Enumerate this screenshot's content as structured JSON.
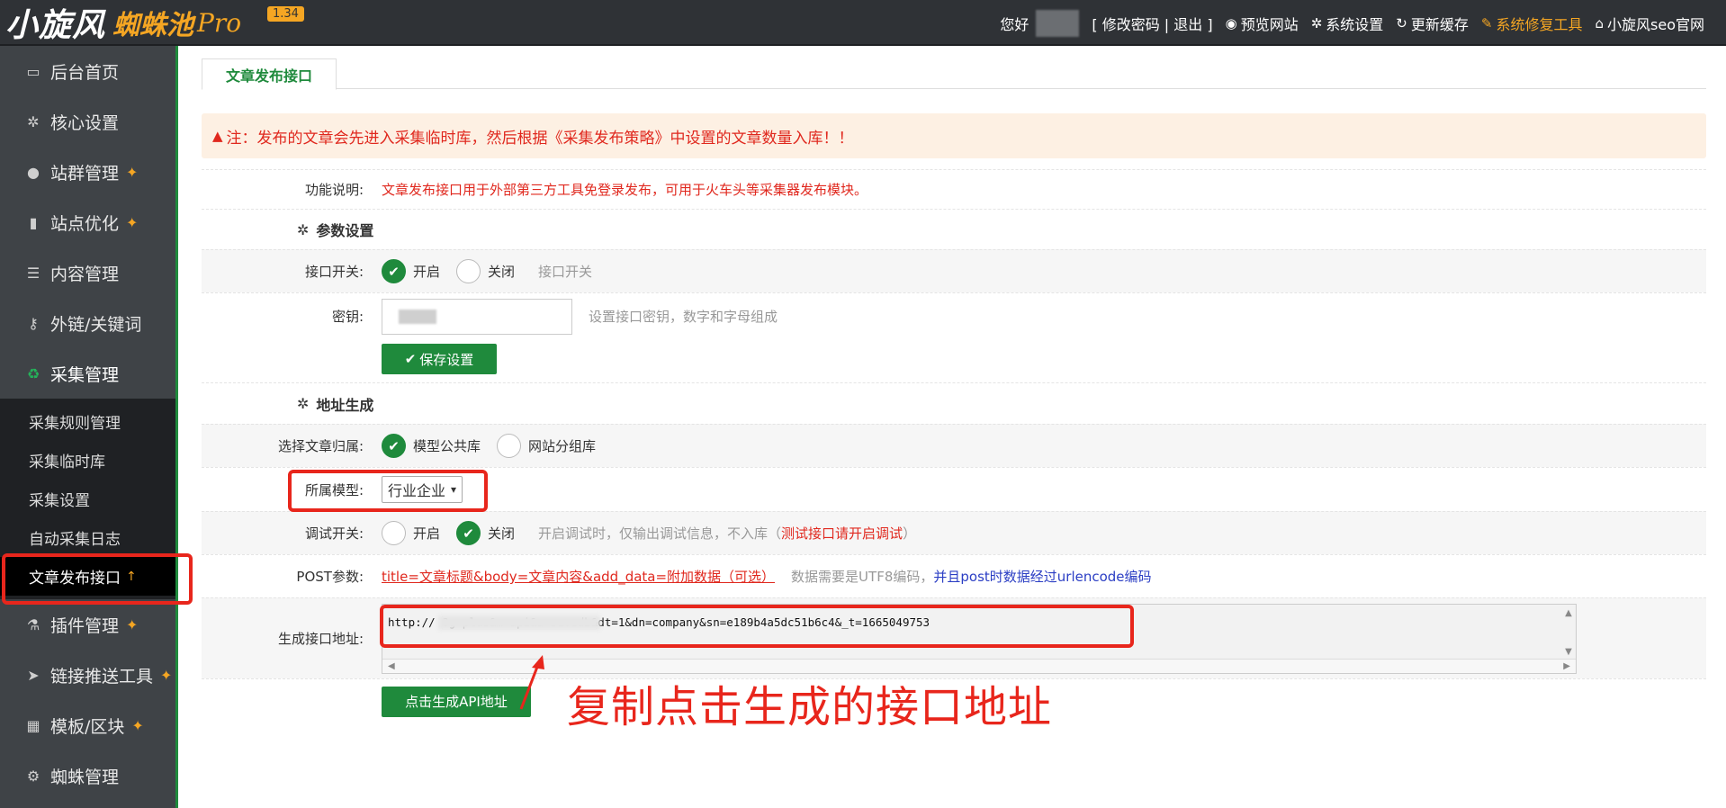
{
  "header": {
    "logo_main": "小旋风",
    "logo_sub": "蜘蛛池",
    "logo_pro": "Pro",
    "version": "1.34",
    "greeting": "您好",
    "account_links": "[ 修改密码 | 退出 ]",
    "nav": [
      {
        "icon": "eye-icon",
        "label": "预览网站"
      },
      {
        "icon": "gear-icon",
        "label": "系统设置"
      },
      {
        "icon": "refresh-icon",
        "label": "更新缓存"
      },
      {
        "icon": "wrench-icon",
        "label": "系统修复工具"
      },
      {
        "icon": "home-icon",
        "label": "小旋风seo官网"
      }
    ]
  },
  "sidebar": {
    "items": [
      {
        "label": "后台首页",
        "icon": "monitor-icon"
      },
      {
        "label": "核心设置",
        "icon": "gear-icon"
      },
      {
        "label": "站群管理",
        "icon": "user-icon",
        "pin": true
      },
      {
        "label": "站点优化",
        "icon": "bar-chart-icon",
        "pin": true
      },
      {
        "label": "内容管理",
        "icon": "document-icon"
      },
      {
        "label": "外链/关键词",
        "icon": "key-icon"
      },
      {
        "label": "采集管理",
        "icon": "recycle-icon",
        "active": true
      },
      {
        "label": "插件管理",
        "icon": "flask-icon",
        "pin": true
      },
      {
        "label": "链接推送工具",
        "icon": "send-icon",
        "pin": true
      },
      {
        "label": "模板/区块",
        "icon": "grid-icon",
        "pin": true
      },
      {
        "label": "蜘蛛管理",
        "icon": "android-icon"
      }
    ],
    "sub_items": [
      "采集规则管理",
      "采集临时库",
      "采集设置",
      "自动采集日志",
      "文章发布接口"
    ],
    "current_sub": "文章发布接口"
  },
  "main": {
    "tab": "文章发布接口",
    "notice": "注：发布的文章会先进入采集临时库，然后根据《采集发布策略》中设置的文章数量入库！！",
    "func_label": "功能说明:",
    "func_desc": "文章发布接口用于外部第三方工具免登录发布，可用于火车头等采集器发布模块。",
    "section_params": "参数设置",
    "switch_label": "接口开关:",
    "switch_on": "开启",
    "switch_off": "关闭",
    "switch_hint": "接口开关",
    "key_label": "密钥:",
    "key_hint": "设置接口密钥，数字和字母组成",
    "save_button": "保存设置",
    "section_url": "地址生成",
    "belong_label": "选择文章归属:",
    "belong_opt1": "模型公共库",
    "belong_opt2": "网站分组库",
    "model_label": "所属模型:",
    "model_value": "行业企业",
    "debug_label": "调试开关:",
    "debug_on": "开启",
    "debug_off": "关闭",
    "debug_hint": "开启调试时，仅输出调试信息，不入库（",
    "debug_hint_red": "测试接口请开启调试",
    "debug_hint_end": "）",
    "post_label": "POST参数:",
    "post_params": "title=文章标题&body=文章内容&add_data=附加数据（可选）",
    "post_hint": "数据需要是UTF8编码，",
    "post_hint_blue": "并且post时数据经过urlencode编码",
    "api_label": "生成接口地址:",
    "api_url": "http://                  ?g=plus&m=api&a=savedb&dt=1&dn=company&sn=e189b4a5dc51b6c4&_t=1665049753",
    "gen_button": "点击生成API地址",
    "annotation": "复制点击生成的接口地址"
  },
  "colors": {
    "accent_green": "#1f8a3c",
    "highlight_red": "#e8261c",
    "topbar": "#2f3236",
    "sidebar": "#3f4347",
    "brand_orange": "#f5a623"
  }
}
